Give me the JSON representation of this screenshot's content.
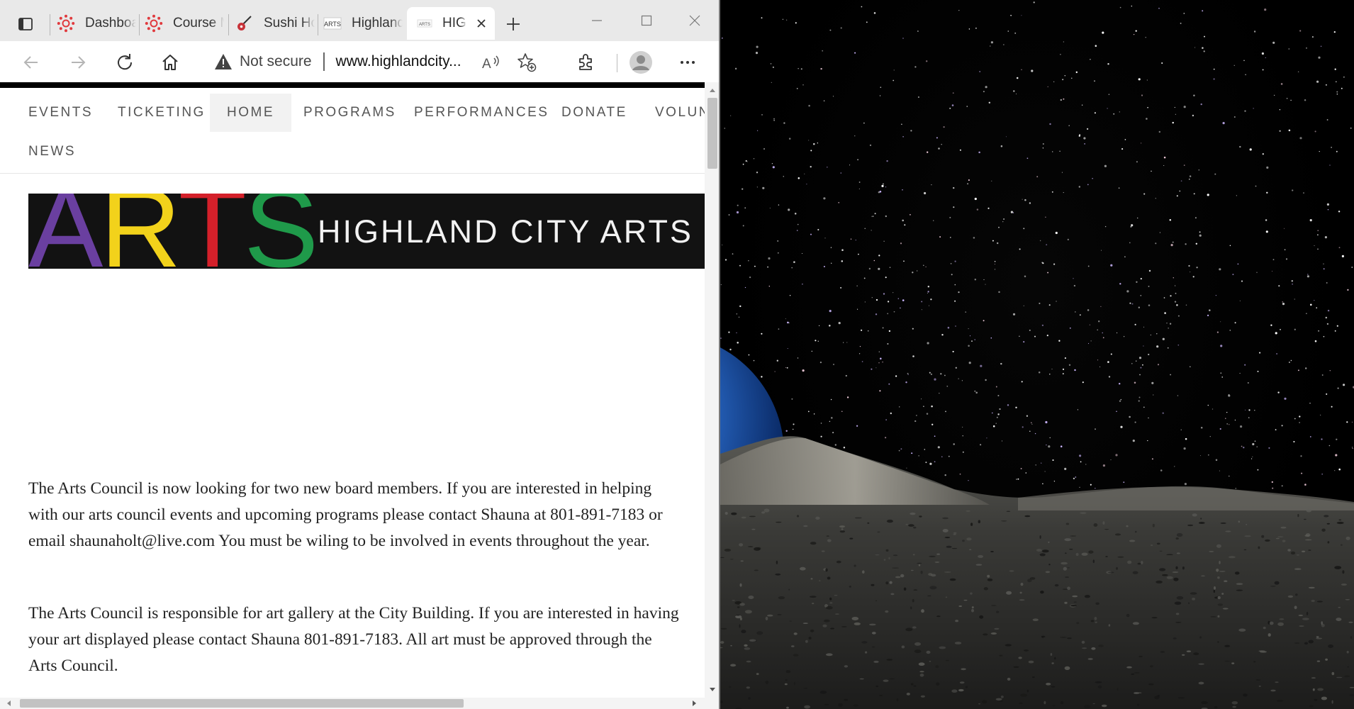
{
  "browser": {
    "tabs": [
      {
        "title": "Dashboard"
      },
      {
        "title": "Course M"
      },
      {
        "title": "Sushi Ho"
      },
      {
        "title": "Highland"
      },
      {
        "title": "HIG",
        "active": true
      }
    ],
    "favicon_text": "ARTS",
    "address": {
      "security_label": "Not secure",
      "url": "www.highlandcity..."
    }
  },
  "page": {
    "nav": [
      {
        "label": "EVENTS"
      },
      {
        "label": "TICKETING"
      },
      {
        "label": "HOME",
        "active": true
      },
      {
        "label": "PROGRAMS"
      },
      {
        "label": "PERFORMANCES"
      },
      {
        "label": "DONATE"
      },
      {
        "label": "VOLUN"
      },
      {
        "label": "NEWS"
      }
    ],
    "banner": {
      "logo_letters": [
        "A",
        "R",
        "T",
        "S"
      ],
      "logo_colors": [
        "#6a3fa0",
        "#f2d21b",
        "#d4202a",
        "#1f9a4a"
      ],
      "title": "HIGHLAND CITY ARTS"
    },
    "paragraphs": [
      "The Arts Council is now looking for two new board members.  If you are interested in helping with our arts council events and upcoming programs please contact Shauna at 801-891-7183 or email shaunaholt@live.com  You must be wiling to be involved in events throughout the year.",
      "The Arts Council is responsible for art gallery at the City Building.  If you are interested in having your art displayed please contact Shauna 801-891-7183.  All art must be approved through the Arts Council."
    ]
  },
  "colors": {
    "canvas_red": "#e03a3e",
    "page_text": "#222222",
    "nav_text": "#555555"
  }
}
